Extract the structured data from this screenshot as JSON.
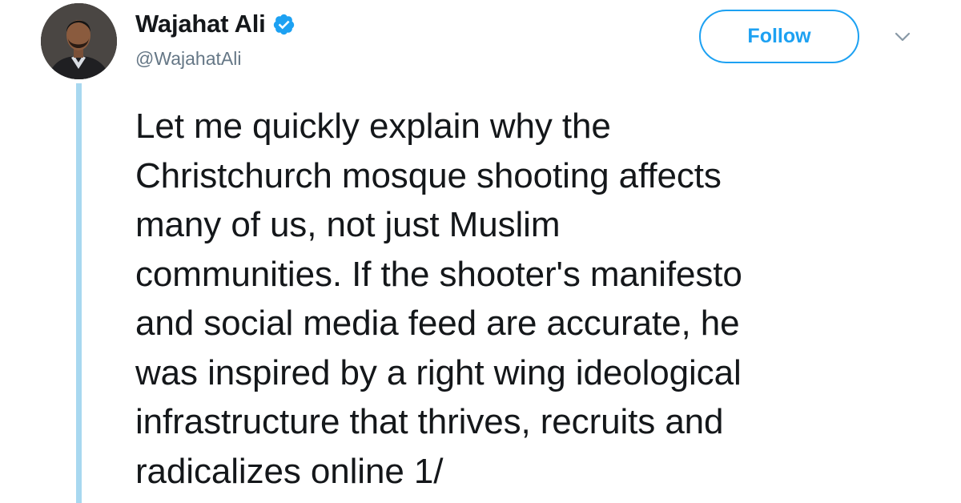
{
  "author": {
    "display_name": "Wajahat Ali",
    "handle": "@WajahatAli",
    "verified": true,
    "avatar_icon": "profile-photo"
  },
  "actions": {
    "follow_label": "Follow",
    "more_icon": "chevron-down-icon"
  },
  "tweet": {
    "text": "Let me quickly explain why the\nChristchurch mosque shooting affects\nmany of us, not just Muslim\ncommunities. If the shooter's manifesto\nand social media feed are accurate, he\nwas inspired by a right wing ideological\ninfrastructure that thrives, recruits and\nradicalizes online 1/"
  },
  "colors": {
    "accent": "#1da1f2",
    "thread_line": "#a8d8f0",
    "handle": "#657786",
    "text": "#14171a"
  }
}
